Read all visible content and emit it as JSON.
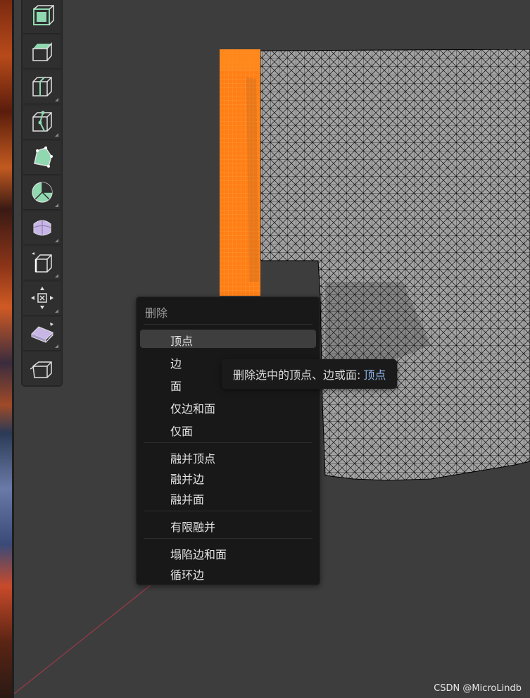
{
  "colors": {
    "viewport_bg": "#3d3d3d",
    "selection": "#ff7f16",
    "mesh_face": "#a3a3a3",
    "mesh_wire": "#000000",
    "menu_bg": "#181818",
    "menu_active": "#3e3e3e",
    "tooltip_highlight": "#8db3e6",
    "tool_green": "#8fd8b0",
    "tool_purple": "#c8b6e6"
  },
  "toolbar": {
    "tools": [
      {
        "icon": "cube-select-icon"
      },
      {
        "icon": "extrude-region-icon"
      },
      {
        "icon": "loop-cut-icon"
      },
      {
        "icon": "knife-icon"
      },
      {
        "icon": "poly-build-icon"
      },
      {
        "icon": "spin-icon"
      },
      {
        "icon": "smooth-icon"
      },
      {
        "icon": "edge-slide-icon"
      },
      {
        "icon": "shrink-fatten-icon"
      },
      {
        "icon": "shear-icon"
      },
      {
        "icon": "rip-region-icon"
      }
    ]
  },
  "menu": {
    "title": "删除",
    "items": [
      {
        "label": "顶点",
        "active": true
      },
      {
        "label": "边"
      },
      {
        "label": "面"
      },
      {
        "label": "仅边和面"
      },
      {
        "label": "仅面"
      },
      {
        "label": "融并顶点"
      },
      {
        "label": "融并边"
      },
      {
        "label": "融并面"
      },
      {
        "label": "有限融并"
      },
      {
        "label": "塌陷边和面"
      },
      {
        "label": "循环边"
      }
    ]
  },
  "tooltip": {
    "text": "删除选中的顶点、边或面:",
    "value": "顶点"
  },
  "watermark": "CSDN @MicroLindb"
}
